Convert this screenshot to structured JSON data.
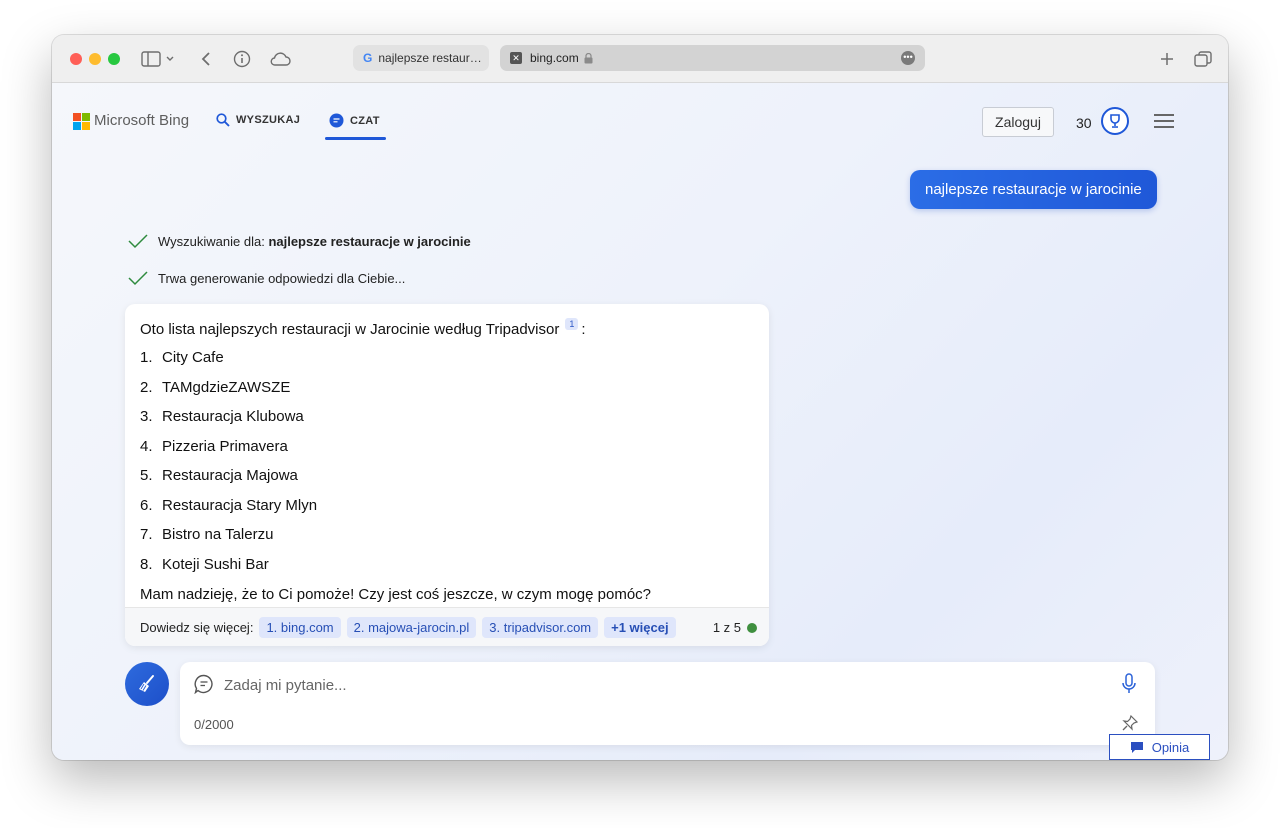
{
  "browser": {
    "tab1_title": "najlepsze restaur…",
    "tab2_title": "bing.com"
  },
  "header": {
    "logo_text": "Microsoft Bing",
    "nav_search": "WYSZUKAJ",
    "nav_chat": "CZAT",
    "signin_label": "Zaloguj",
    "points": "30"
  },
  "chat": {
    "user_message": "najlepsze restauracje w jarocinie",
    "status1_prefix": "Wyszukiwanie dla: ",
    "status1_query": "najlepsze restauracje w jarocinie",
    "status2": "Trwa generowanie odpowiedzi dla Ciebie...",
    "answer_intro": "Oto lista najlepszych restauracji w Jarocinie według Tripadvisor",
    "answer_intro_ref": "1",
    "answer_intro_colon": ":",
    "restaurants": [
      {
        "num": "1.",
        "name": "City Cafe"
      },
      {
        "num": "2.",
        "name": "TAMgdzieZAWSZE"
      },
      {
        "num": "3.",
        "name": "Restauracja Klubowa"
      },
      {
        "num": "4.",
        "name": "Pizzeria Primavera"
      },
      {
        "num": "5.",
        "name": "Restauracja Majowa"
      },
      {
        "num": "6.",
        "name": "Restauracja Stary Mlyn"
      },
      {
        "num": "7.",
        "name": "Bistro na Talerzu"
      },
      {
        "num": "8.",
        "name": "Koteji Sushi Bar"
      }
    ],
    "answer_closing": "Mam nadzieję, że to Ci pomoże! Czy jest coś jeszcze, w czym mogę pomóc?",
    "learn_more_label": "Dowiedz się więcej:",
    "sources": [
      "1. bing.com",
      "2. majowa-jarocin.pl",
      "3. tripadvisor.com"
    ],
    "more_sources": "+1 więcej",
    "turn_counter": "1 z 5"
  },
  "input": {
    "placeholder": "Zadaj mi pytanie...",
    "char_count": "0/2000"
  },
  "feedback_label": "Opinia",
  "colors": {
    "accent": "#1f58d8",
    "status_green": "#3f8f3f",
    "chip_bg": "#dfe6fb"
  }
}
